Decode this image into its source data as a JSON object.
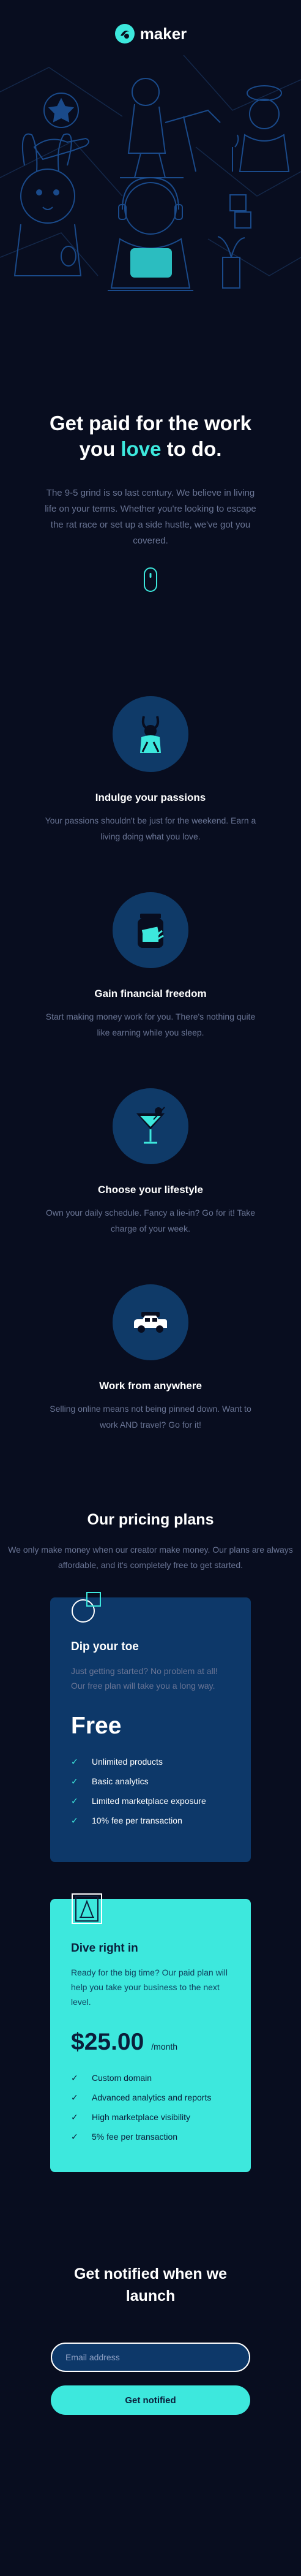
{
  "brand": {
    "name": "maker",
    "accent": "#3de8dd",
    "background": "#080d1f",
    "card_blue": "#0d3869"
  },
  "hero": {
    "headline_pre": "Get paid for the work you ",
    "headline_accent": "love",
    "headline_post": " to do.",
    "body": "The 9-5 grind is so last century. We believe in living life on your terms. Whether you're looking to escape the rat race or set up a side hustle, we've got you covered.",
    "scroll_icon": "mouse-scroll-icon"
  },
  "features": [
    {
      "icon": "bunny-passion-icon",
      "title": "Indulge your passions",
      "text": "Your passions shouldn't be just for the weekend. Earn a living doing what you love."
    },
    {
      "icon": "money-jar-icon",
      "title": "Gain financial freedom",
      "text": "Start making money work for you. There's nothing quite like earning while you sleep."
    },
    {
      "icon": "cocktail-icon",
      "title": "Choose your lifestyle",
      "text": "Own your daily schedule. Fancy a lie-in? Go for it! Take charge of your week."
    },
    {
      "icon": "car-travel-icon",
      "title": "Work from anywhere",
      "text": "Selling online means not being pinned down. Want to work AND travel? Go for it!"
    }
  ],
  "pricing": {
    "title": "Our pricing plans",
    "subtitle": "We only make money when our creator make money. Our plans are always affordable, and it's completely free to get started.",
    "plans": [
      {
        "name": "Dip your toe",
        "description": "Just getting started? No problem at all! Our free plan will take you a long way.",
        "price": "Free",
        "period": "",
        "features": [
          "Unlimited products",
          "Basic analytics",
          "Limited marketplace exposure",
          "10% fee per transaction"
        ]
      },
      {
        "name": "Dive right in",
        "description": "Ready for the big time? Our paid plan will help you take your business to the next level.",
        "price": "$25.00",
        "period": "/month",
        "features": [
          "Custom domain",
          "Advanced analytics and reports",
          "High marketplace visibility",
          "5% fee per transaction"
        ]
      }
    ]
  },
  "notify": {
    "title": "Get notified when we launch",
    "email_placeholder": "Email address",
    "button_label": "Get notified"
  }
}
